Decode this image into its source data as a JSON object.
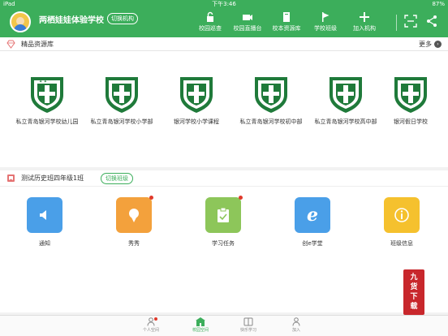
{
  "status": {
    "carrier": "iPad",
    "time": "下午3:46",
    "battery": "87%"
  },
  "header": {
    "school_name": "两栖娃娃体验学校",
    "switch_org_label": "切换机构",
    "nav": [
      {
        "label": "校园巡查",
        "icon": "lock-icon"
      },
      {
        "label": "校园直播台",
        "icon": "camera-icon"
      },
      {
        "label": "校本资源库",
        "icon": "book-icon"
      },
      {
        "label": "学校班级",
        "icon": "flag-icon"
      },
      {
        "label": "加入机构",
        "icon": "plus-icon"
      }
    ]
  },
  "resources": {
    "title": "精品资源库",
    "more_label": "更多",
    "items": [
      {
        "name": "私立青岛银河学校幼儿园"
      },
      {
        "name": "私立青岛银河学校小学部"
      },
      {
        "name": "银河学校小学课程"
      },
      {
        "name": "私立青岛银河学校初中部"
      },
      {
        "name": "私立青岛银河学校高中部"
      },
      {
        "name": "银河假日学校"
      }
    ]
  },
  "class_section": {
    "title": "测试历史班四年级1班",
    "switch_label": "切换班级",
    "apps": [
      {
        "label": "通知",
        "color": "#4a9fe8",
        "icon": "speaker-icon",
        "badge": false
      },
      {
        "label": "秀秀",
        "color": "#f3a13c",
        "icon": "ice-cream-icon",
        "badge": true
      },
      {
        "label": "学习任务",
        "color": "#8dc65a",
        "icon": "clipboard-icon",
        "badge": true
      },
      {
        "label": "创e学堂",
        "color": "#4a9fe8",
        "icon": "e-icon",
        "badge": false
      },
      {
        "label": "班级信息",
        "color": "#f5c12e",
        "icon": "info-icon",
        "badge": false
      }
    ]
  },
  "watermark": {
    "text": "九货下载"
  },
  "tabbar": {
    "items": [
      {
        "label": "个人空间",
        "icon": "person-icon",
        "active": false,
        "badge": true
      },
      {
        "label": "校园空间",
        "icon": "school-icon",
        "active": true,
        "badge": false
      },
      {
        "label": "快乐学习",
        "icon": "book-open-icon",
        "active": false,
        "badge": false
      },
      {
        "label": "加入",
        "icon": "person-add-icon",
        "active": false,
        "badge": false
      }
    ]
  },
  "colors": {
    "brand": "#3cae5b",
    "badge": "#e0392b",
    "shield": "#1f7a3a"
  }
}
